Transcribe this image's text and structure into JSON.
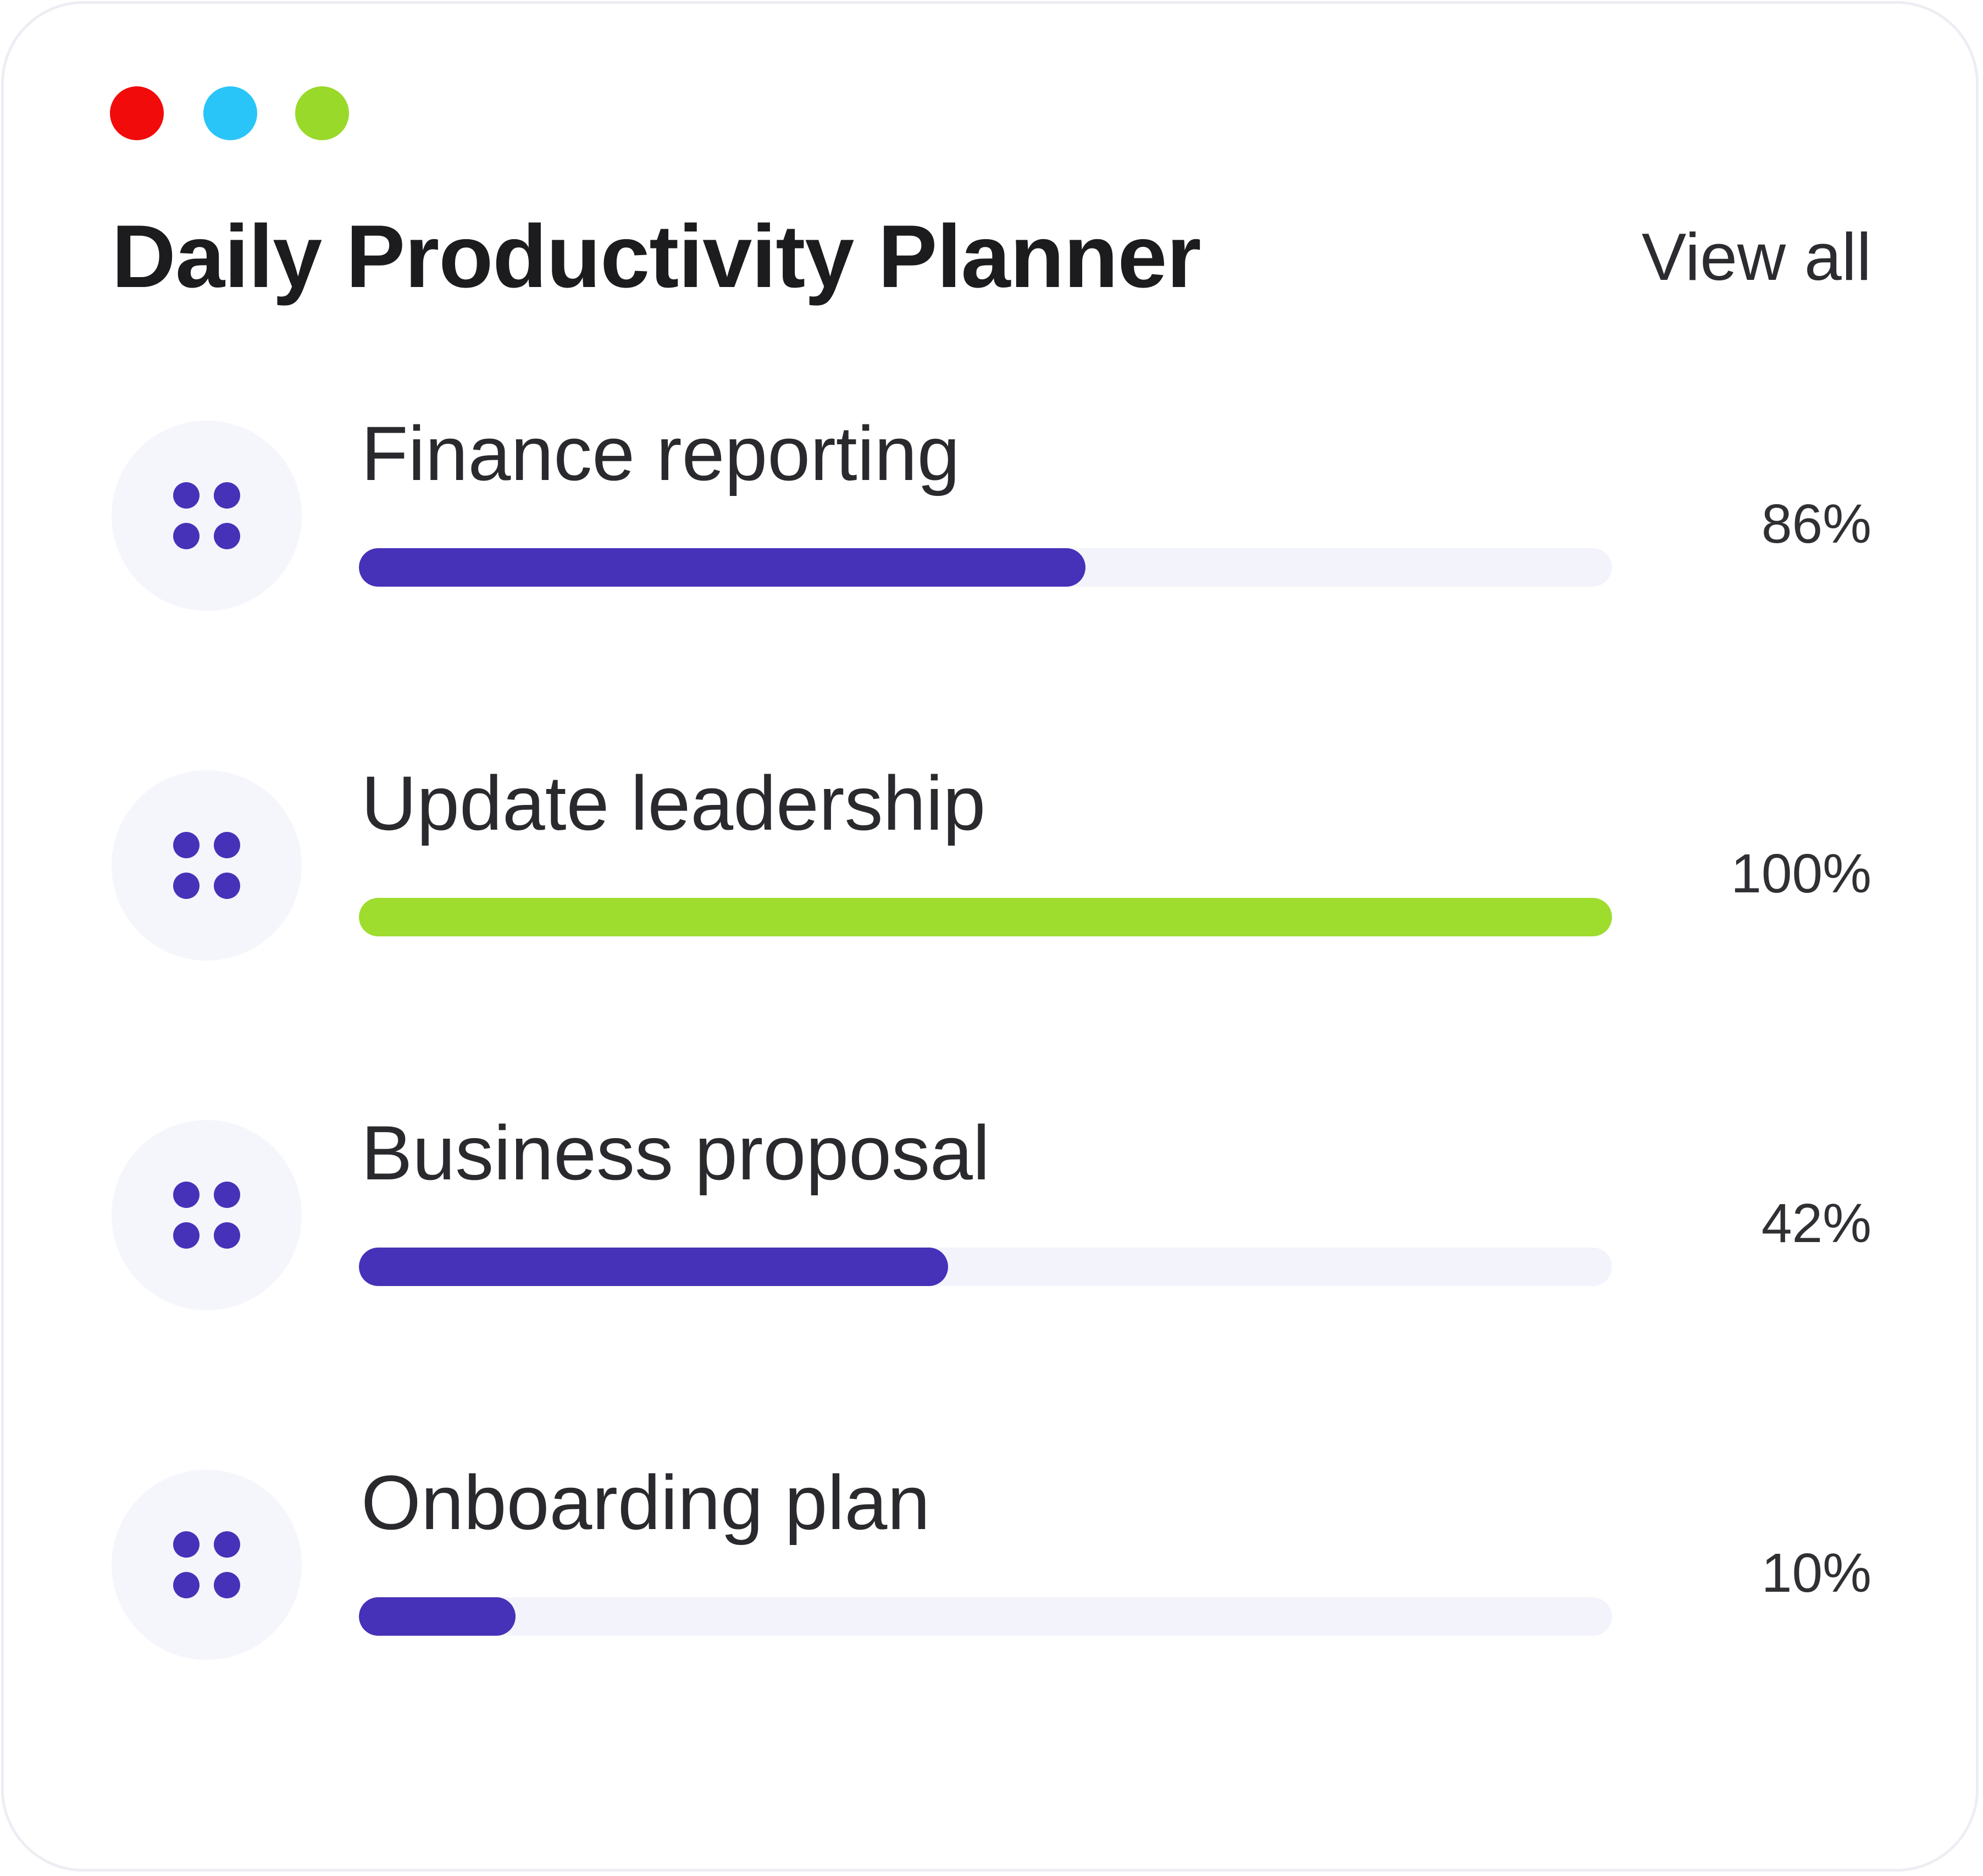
{
  "window_controls": [
    {
      "name": "close",
      "color": "#f20b0b"
    },
    {
      "name": "minimize",
      "color": "#29c5f9"
    },
    {
      "name": "maximize",
      "color": "#99d92a"
    }
  ],
  "header": {
    "title": "Daily Productivity Planner",
    "view_all_label": "View all"
  },
  "tasks": [
    {
      "name": "Finance reporting",
      "percent_label": "86%",
      "progress": 0.58,
      "color": "#4532b8",
      "icon": "grid-dots-icon"
    },
    {
      "name": "Update leadership",
      "percent_label": "100%",
      "progress": 1.0,
      "color": "#9edc2e",
      "icon": "grid-dots-icon"
    },
    {
      "name": "Business proposal",
      "percent_label": "42%",
      "progress": 0.47,
      "color": "#4532b8",
      "icon": "grid-dots-icon"
    },
    {
      "name": "Onboarding plan",
      "percent_label": "10%",
      "progress": 0.125,
      "color": "#4532b8",
      "icon": "grid-dots-icon"
    }
  ],
  "colors": {
    "accent": "#4532b8",
    "complete": "#9edc2e",
    "track": "#f3f4fb",
    "icon_bg": "#f5f5fc"
  }
}
